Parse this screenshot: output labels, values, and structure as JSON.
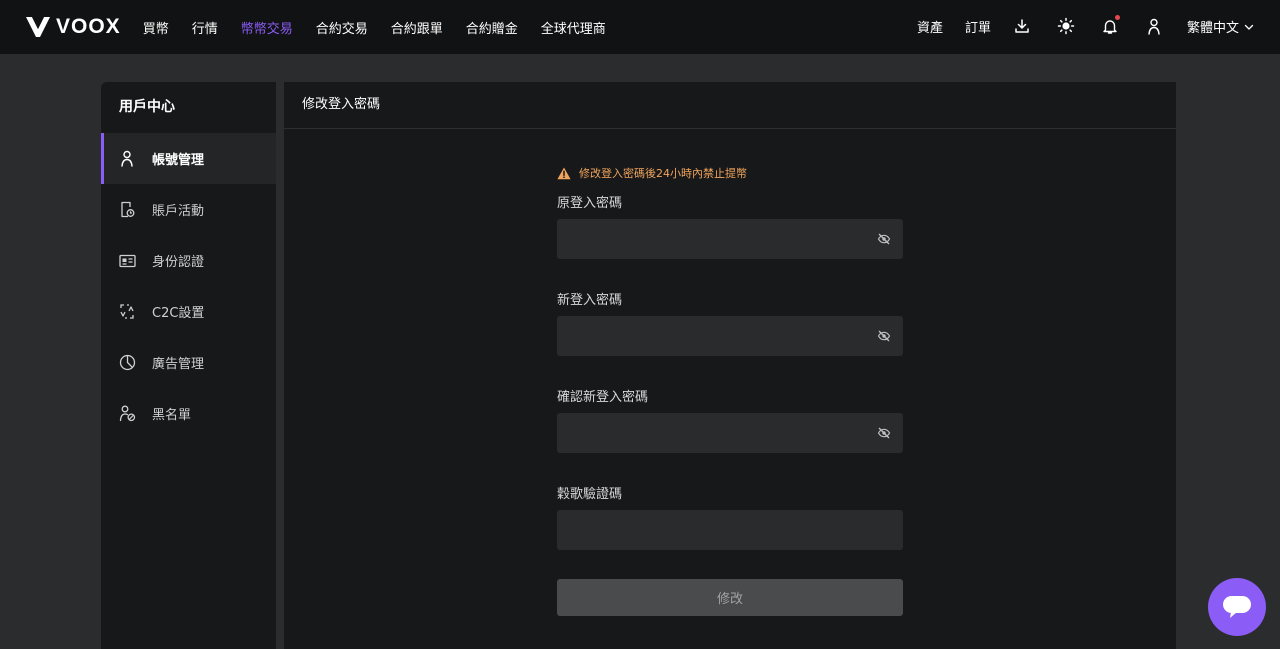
{
  "brand": {
    "name": "VOOX",
    "accent": "#8b5cf6",
    "warning": "#f0a45d",
    "notify_dot": "#e5484d"
  },
  "nav": {
    "items": [
      {
        "label": "買幣",
        "active": false
      },
      {
        "label": "行情",
        "active": false
      },
      {
        "label": "幣幣交易",
        "active": true
      },
      {
        "label": "合約交易",
        "active": false
      },
      {
        "label": "合約跟單",
        "active": false
      },
      {
        "label": "合約贈金",
        "active": false
      },
      {
        "label": "全球代理商",
        "active": false
      }
    ],
    "assets_label": "資產",
    "orders_label": "訂單",
    "language": "繁體中文",
    "icons": [
      "download-icon",
      "theme-sun-icon",
      "bell-icon",
      "user-icon",
      "chevron-down-icon"
    ]
  },
  "sidebar": {
    "title": "用戶中心",
    "items": [
      {
        "label": "帳號管理",
        "icon": "user-icon",
        "active": true
      },
      {
        "label": "賬戶活動",
        "icon": "activity-doc-icon",
        "active": false
      },
      {
        "label": "身份認證",
        "icon": "id-card-icon",
        "active": false
      },
      {
        "label": "C2C設置",
        "icon": "exchange-icon",
        "active": false
      },
      {
        "label": "廣告管理",
        "icon": "pie-chart-icon",
        "active": false
      },
      {
        "label": "黑名單",
        "icon": "user-block-icon",
        "active": false
      }
    ]
  },
  "panel": {
    "title": "修改登入密碼",
    "warning": "修改登入密碼後24小時內禁止提幣",
    "fields": {
      "old_password": {
        "label": "原登入密碼",
        "value": "",
        "placeholder": ""
      },
      "new_password": {
        "label": "新登入密碼",
        "value": "",
        "placeholder": ""
      },
      "confirm_password": {
        "label": "確認新登入密碼",
        "value": "",
        "placeholder": ""
      },
      "google_code": {
        "label": "穀歌驗證碼",
        "value": "",
        "placeholder": ""
      }
    },
    "submit_label": "修改"
  }
}
